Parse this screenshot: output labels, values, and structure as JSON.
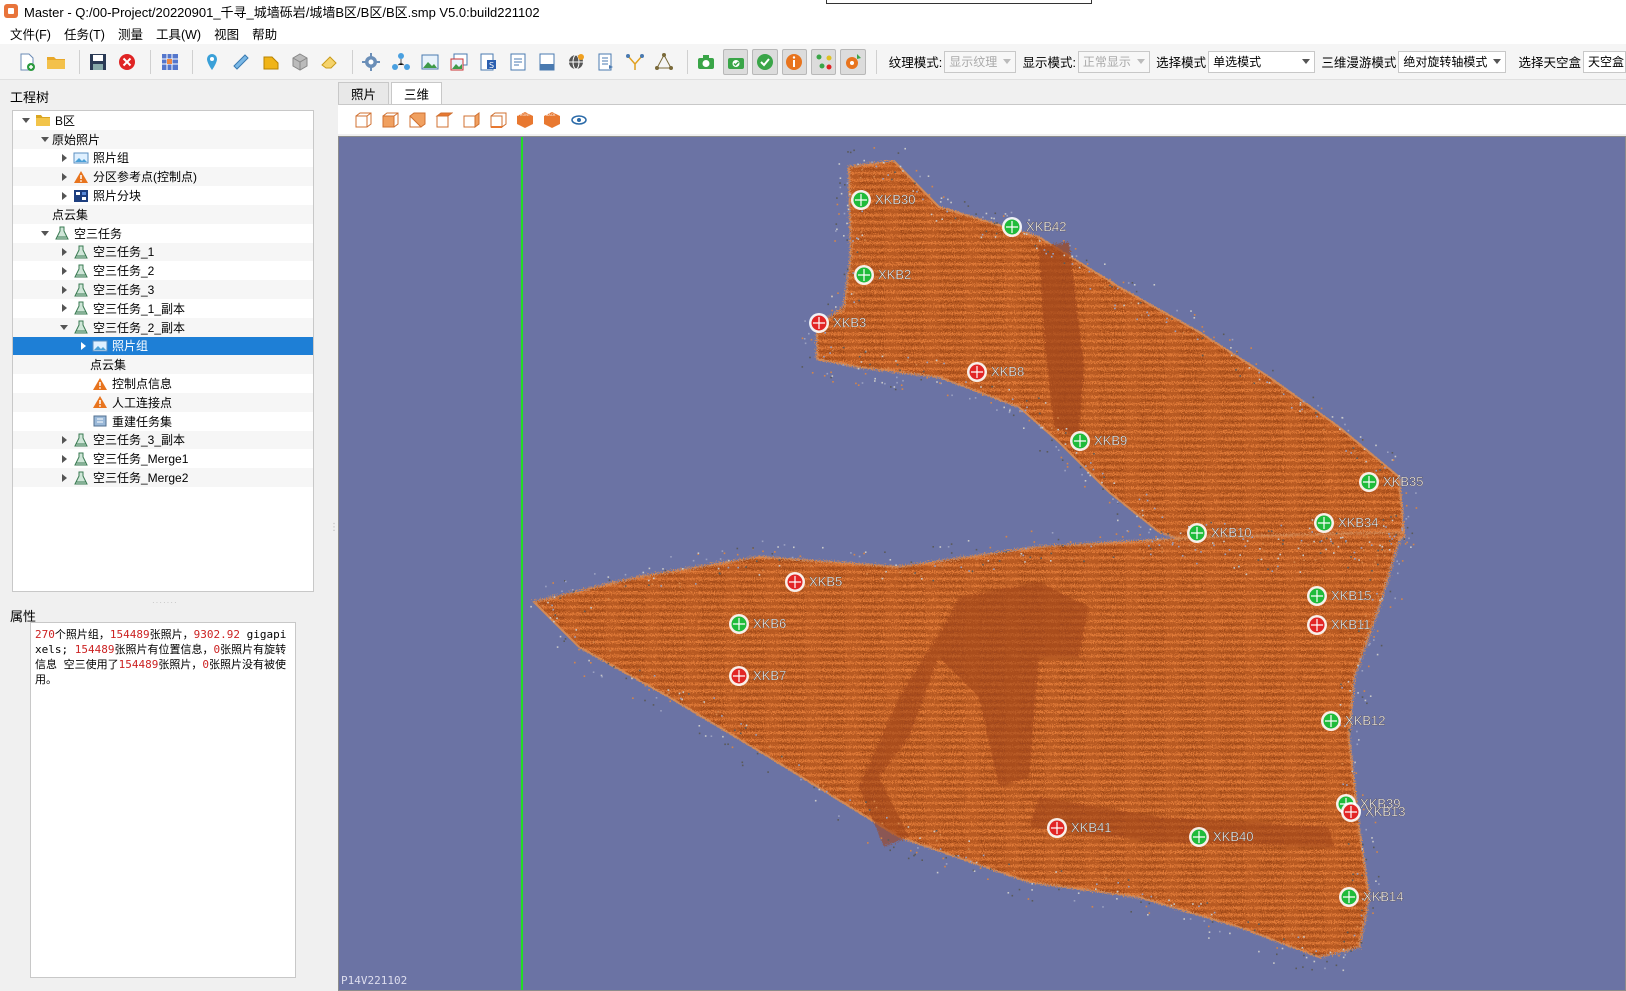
{
  "window": {
    "title": "Master - Q:/00-Project/20220901_千寻_城墙砾岩/城墙B区/B区/B区.smp  V5.0:build221102"
  },
  "menu": [
    "文件(F)",
    "任务(T)",
    "测量",
    "工具(W)",
    "视图",
    "帮助"
  ],
  "toolbar": {
    "icons": [
      "new-project-icon",
      "open-folder-icon",
      "save-icon",
      "close-red-icon",
      "grid-icon",
      "pin-icon",
      "ruler-icon",
      "area-icon",
      "cube-icon",
      "eraser-icon",
      "settings-gear-icon",
      "network-icon",
      "image-icon",
      "images-icon",
      "s-doc-icon",
      "text-doc-icon",
      "log-icon",
      "globe-icon",
      "export-icon",
      "triangulate-icon",
      "tie-points-icon",
      "camera-icon",
      "camera-check-icon",
      "check-icon",
      "info-icon",
      "dots-icon",
      "marker-icon"
    ],
    "texture_mode_label": "纹理模式:",
    "texture_mode_value": "显示纹理",
    "display_mode_label": "显示模式:",
    "display_mode_value": "正常显示",
    "select_mode_label": "选择模式",
    "select_mode_value": "单选模式",
    "nav_mode_label": "三维漫游模式",
    "nav_mode_value": "绝对旋转轴模式",
    "skybox_label": "选择天空盒",
    "skybox_value": "天空盒"
  },
  "left_panel": {
    "tree_title": "工程树",
    "tree": [
      {
        "label": "B区",
        "level": 0,
        "toggle": "expanded",
        "icon": "folder"
      },
      {
        "label": "原始照片",
        "level": 1,
        "toggle": "expanded",
        "icon": "none"
      },
      {
        "label": "照片组",
        "level": 2,
        "toggle": "collapsed",
        "icon": "photo"
      },
      {
        "label": "分区参考点(控制点)",
        "level": 2,
        "toggle": "collapsed",
        "icon": "warning"
      },
      {
        "label": "照片分块",
        "level": 2,
        "toggle": "collapsed",
        "icon": "blocks"
      },
      {
        "label": "点云集",
        "level": 1,
        "toggle": "none",
        "icon": "none"
      },
      {
        "label": "空三任务",
        "level": 1,
        "toggle": "expanded",
        "icon": "flask"
      },
      {
        "label": "空三任务_1",
        "level": 2,
        "toggle": "collapsed",
        "icon": "flask"
      },
      {
        "label": "空三任务_2",
        "level": 2,
        "toggle": "collapsed",
        "icon": "flask"
      },
      {
        "label": "空三任务_3",
        "level": 2,
        "toggle": "collapsed",
        "icon": "flask"
      },
      {
        "label": "空三任务_1_副本",
        "level": 2,
        "toggle": "collapsed",
        "icon": "flask"
      },
      {
        "label": "空三任务_2_副本",
        "level": 2,
        "toggle": "expanded",
        "icon": "flask"
      },
      {
        "label": "照片组",
        "level": 3,
        "toggle": "collapsed",
        "icon": "photo",
        "selected": true
      },
      {
        "label": "点云集",
        "level": 3,
        "toggle": "none",
        "icon": "none"
      },
      {
        "label": "控制点信息",
        "level": 3,
        "toggle": "none",
        "icon": "warning"
      },
      {
        "label": "人工连接点",
        "level": 3,
        "toggle": "none",
        "icon": "warning"
      },
      {
        "label": "重建任务集",
        "level": 3,
        "toggle": "none",
        "icon": "rebuild"
      },
      {
        "label": "空三任务_3_副本",
        "level": 2,
        "toggle": "collapsed",
        "icon": "flask"
      },
      {
        "label": "空三任务_Merge1",
        "level": 2,
        "toggle": "collapsed",
        "icon": "flask"
      },
      {
        "label": "空三任务_Merge2",
        "level": 2,
        "toggle": "collapsed",
        "icon": "flask"
      }
    ],
    "props_title": "属性",
    "props": {
      "n1": "270",
      "t1": "个照片组，",
      "n2": "154489",
      "t2": "张照片，",
      "n3": "9302.92",
      "t3": " gigapixels; ",
      "n4": "154489",
      "t4": "张照片有位置信息，",
      "n5": "0",
      "t5": "张照片有旋转信息 空三使用了",
      "n6": "154489",
      "t6": "张照片，",
      "n7": "0",
      "t7": "张照片没有被使用。"
    }
  },
  "tabs": [
    {
      "label": "照片",
      "active": false
    },
    {
      "label": "三维",
      "active": true
    }
  ],
  "view_toolbar": {
    "icons": [
      "view-cube-1-icon",
      "view-cube-2-icon",
      "view-cube-3-icon",
      "view-cube-4-icon",
      "view-cube-5-icon",
      "view-cube-6-icon",
      "view-front-icon",
      "view-back-icon",
      "view-eye-icon"
    ],
    "front_label": "FRONT",
    "back_label": "BACK"
  },
  "viewport": {
    "label": "P14V221102",
    "colors": {
      "background": "#6b73a4",
      "cloud": "#c8642a",
      "cloud_dark": "#a24d1c",
      "green_marker": "#1fbb3a",
      "red_marker": "#e22525",
      "guide_line": "#22dd22"
    },
    "markers": [
      {
        "label": "XKB30",
        "status": "green"
      },
      {
        "label": "XKB42",
        "status": "green"
      },
      {
        "label": "XKB2",
        "status": "green"
      },
      {
        "label": "XKB3",
        "status": "red"
      },
      {
        "label": "XKB8",
        "status": "red"
      },
      {
        "label": "XKB9",
        "status": "green"
      },
      {
        "label": "XKB35",
        "status": "green"
      },
      {
        "label": "XKB34",
        "status": "green"
      },
      {
        "label": "XKB10",
        "status": "green"
      },
      {
        "label": "XKB5",
        "status": "red"
      },
      {
        "label": "XKB6",
        "status": "green"
      },
      {
        "label": "XKB15",
        "status": "green"
      },
      {
        "label": "XKB11",
        "status": "red"
      },
      {
        "label": "XKB7",
        "status": "red"
      },
      {
        "label": "XKB12",
        "status": "green"
      },
      {
        "label": "XKB39",
        "status": "green"
      },
      {
        "label": "XKB13",
        "status": "red"
      },
      {
        "label": "XKB41",
        "status": "red"
      },
      {
        "label": "XKB40",
        "status": "green"
      },
      {
        "label": "XKB14",
        "status": "green"
      }
    ]
  }
}
